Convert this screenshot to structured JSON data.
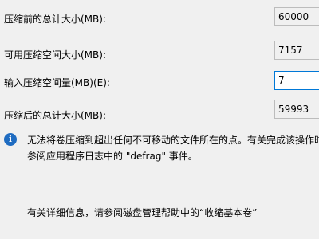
{
  "rows": [
    {
      "label": "压缩前的总计大小(MB):",
      "value": "60000"
    },
    {
      "label": "可用压缩空间大小(MB):",
      "value": "7157"
    },
    {
      "label": "输入压缩空间量(MB)(E):",
      "value": "7"
    },
    {
      "label": "压缩后的总计大小(MB):",
      "value": "59993"
    }
  ],
  "info": {
    "icon": "info-icon",
    "line1": "无法将卷压缩到超出任何不可移动的文件所在的点。有关完成该操作时间",
    "line2": "参阅应用程序日志中的 \"defrag\" 事件。"
  },
  "help_text": "有关详细信息，请参阅磁盘管理帮助中的“收缩基本卷”",
  "colors": {
    "background": "#f0f0f0",
    "focus_border": "#0078d7",
    "info_icon": "#1f6cc1"
  }
}
